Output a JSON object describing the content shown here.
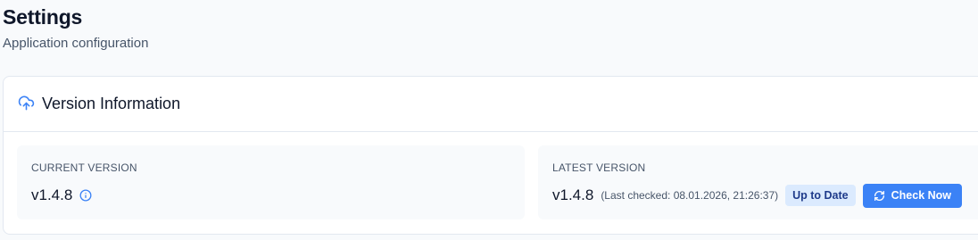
{
  "header": {
    "title": "Settings",
    "subtitle": "Application configuration"
  },
  "version_card": {
    "title": "Version Information",
    "icon": "cloud-upload-icon",
    "current": {
      "label": "CURRENT VERSION",
      "value": "v1.4.8",
      "icon": "info-icon"
    },
    "latest": {
      "label": "LATEST VERSION",
      "value": "v1.4.8",
      "last_checked": "(Last checked: 08.01.2026, 21:26:37)",
      "status_badge": "Up to Date",
      "check_button": "Check Now",
      "check_icon": "refresh-icon"
    }
  },
  "colors": {
    "accent": "#3b82f6",
    "badge_bg": "#dbeafe",
    "badge_text": "#1e3a8a",
    "background": "#f8fafc",
    "card": "#ffffff"
  }
}
